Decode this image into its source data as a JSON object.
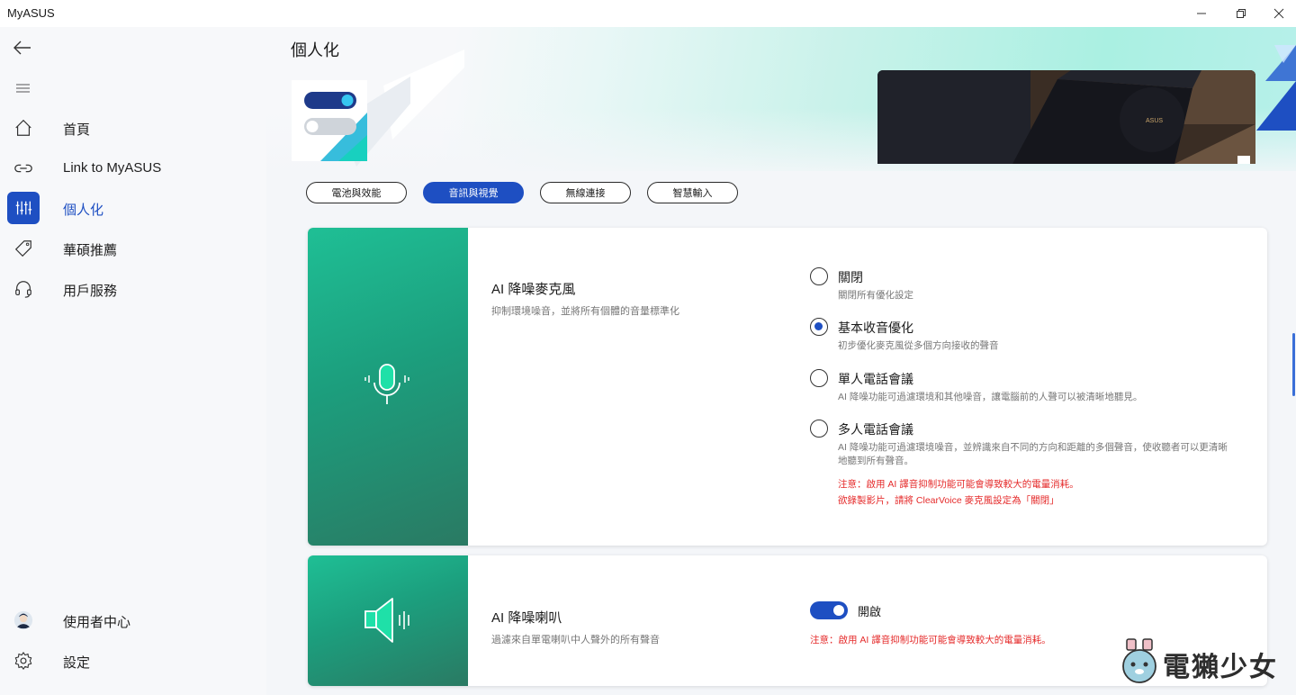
{
  "app": {
    "title": "MyASUS"
  },
  "window_controls": [
    "minimize",
    "restore",
    "close"
  ],
  "sidebar": {
    "items": [
      {
        "label": "首頁",
        "icon": "home-icon"
      },
      {
        "label": "Link to MyASUS",
        "icon": "link-icon"
      },
      {
        "label": "個人化",
        "icon": "sliders-icon",
        "active": true
      },
      {
        "label": "華碩推薦",
        "icon": "tag-icon"
      },
      {
        "label": "用戶服務",
        "icon": "headset-icon"
      }
    ],
    "bottom": [
      {
        "label": "使用者中心",
        "icon": "avatar-icon"
      },
      {
        "label": "設定",
        "icon": "gear-icon"
      }
    ]
  },
  "page": {
    "title": "個人化"
  },
  "tabs": [
    {
      "label": "電池與效能",
      "active": false
    },
    {
      "label": "音訊與視覺",
      "active": true
    },
    {
      "label": "無線連接",
      "active": false
    },
    {
      "label": "智慧輸入",
      "active": false
    }
  ],
  "cards": {
    "mic": {
      "title": "AI 降噪麥克風",
      "desc": "抑制環境噪音，並將所有個體的音量標準化",
      "icon": "microphone-icon",
      "options": [
        {
          "label": "關閉",
          "desc": "關閉所有優化設定",
          "selected": false
        },
        {
          "label": "基本收音優化",
          "desc": "初步優化麥克風從多個方向接收的聲音",
          "selected": true
        },
        {
          "label": "單人電話會議",
          "desc": "AI 降噪功能可過濾環境和其他噪音，讓電腦前的人聲可以被清晰地聽見。",
          "selected": false
        },
        {
          "label": "多人電話會議",
          "desc": "AI 降噪功能可過濾環境噪音，並辨識來自不同的方向和距離的多個聲音，使收聽者可以更清晰地聽到所有聲音。",
          "selected": false
        }
      ],
      "warning_1": "注意：啟用 AI 譯音抑制功能可能會導致較大的電量消耗。",
      "warning_2": "欲錄製影片，請將 ClearVoice 麥克風設定為「關閉」"
    },
    "speaker": {
      "title": "AI 降噪喇叭",
      "desc": "過濾來自單電喇叭中人聲外的所有聲音",
      "icon": "speaker-icon",
      "toggle_label": "開啟",
      "toggle_on": true,
      "warning": "注意：啟用 AI 譯音抑制功能可能會導致較大的電量消耗。"
    }
  },
  "watermark": {
    "text": "電獺少女"
  },
  "colors": {
    "accent": "#1e4fc2",
    "teal": "#1fbf95",
    "warning": "#e52b2b"
  }
}
